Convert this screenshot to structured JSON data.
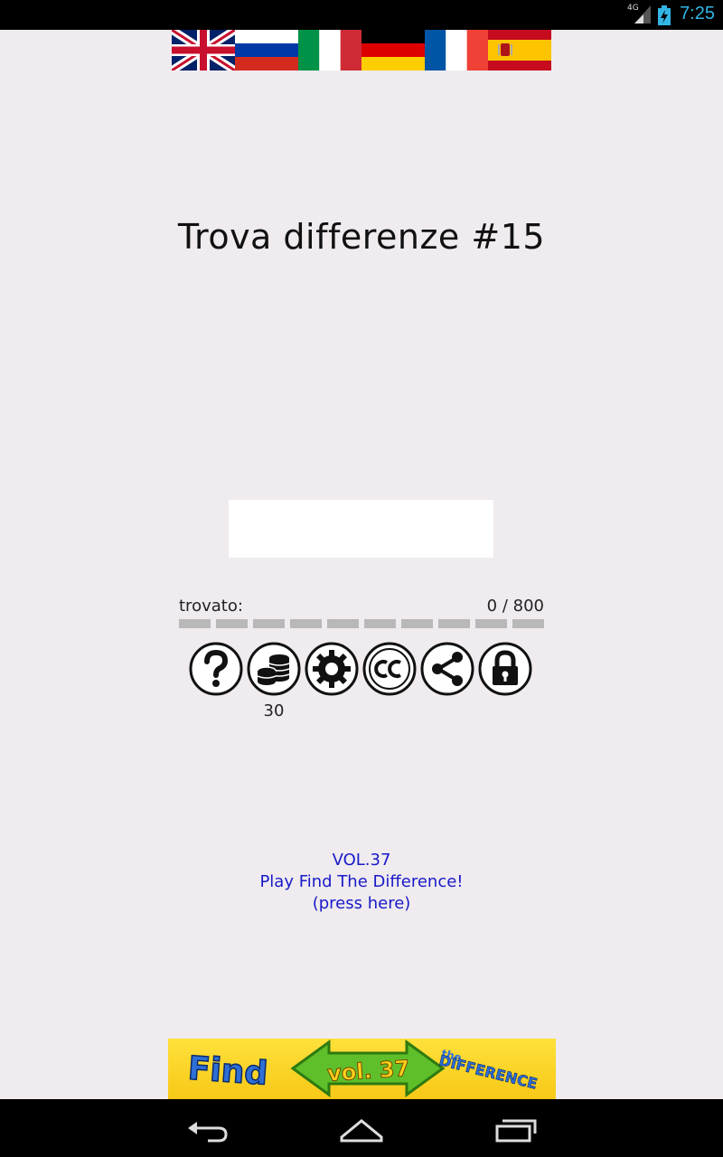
{
  "status_bar": {
    "network": "4G",
    "time": "7:25",
    "accent_color": "#33b5e5"
  },
  "flags": [
    {
      "name": "english",
      "icon": "uk-flag-icon"
    },
    {
      "name": "russian",
      "icon": "russia-flag-icon"
    },
    {
      "name": "italian",
      "icon": "italy-flag-icon"
    },
    {
      "name": "german",
      "icon": "germany-flag-icon"
    },
    {
      "name": "french",
      "icon": "france-flag-icon"
    },
    {
      "name": "spanish",
      "icon": "spain-flag-icon"
    }
  ],
  "title": "Trova differenze #15",
  "progress": {
    "label": "trovato:",
    "count": "0 / 800",
    "found": 0,
    "total": 800,
    "segments": 10,
    "segment_color": "#b8b8b8"
  },
  "toolbar": [
    {
      "name": "help",
      "icon": "question-mark-icon"
    },
    {
      "name": "coins",
      "icon": "coins-icon"
    },
    {
      "name": "settings",
      "icon": "gear-icon"
    },
    {
      "name": "creative-commons",
      "icon": "cc-icon"
    },
    {
      "name": "share",
      "icon": "share-icon"
    },
    {
      "name": "lock",
      "icon": "lock-icon"
    }
  ],
  "coins_count": "30",
  "promo": {
    "line1": "VOL.37",
    "line2": "Play Find The Difference!",
    "line3": "(press here)",
    "color": "#1a1ac8"
  },
  "banner": {
    "word1": "Find",
    "volume": "vol. 37",
    "word2_small": "the",
    "word2": "DIFFERENCE"
  },
  "nav_bar": {
    "buttons": [
      "back-icon",
      "home-icon",
      "recent-apps-icon"
    ]
  }
}
